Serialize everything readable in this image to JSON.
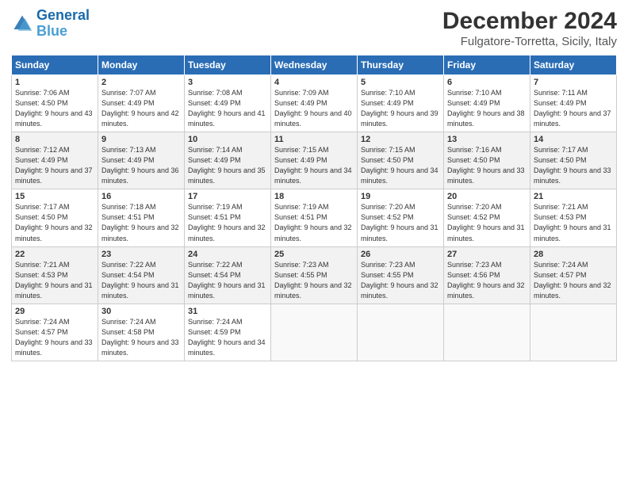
{
  "header": {
    "logo_line1": "General",
    "logo_line2": "Blue",
    "main_title": "December 2024",
    "subtitle": "Fulgatore-Torretta, Sicily, Italy"
  },
  "days_of_week": [
    "Sunday",
    "Monday",
    "Tuesday",
    "Wednesday",
    "Thursday",
    "Friday",
    "Saturday"
  ],
  "weeks": [
    [
      {
        "day": 1,
        "rise": "7:06 AM",
        "set": "4:50 PM",
        "daylight": "9 hours and 43 minutes."
      },
      {
        "day": 2,
        "rise": "7:07 AM",
        "set": "4:49 PM",
        "daylight": "9 hours and 42 minutes."
      },
      {
        "day": 3,
        "rise": "7:08 AM",
        "set": "4:49 PM",
        "daylight": "9 hours and 41 minutes."
      },
      {
        "day": 4,
        "rise": "7:09 AM",
        "set": "4:49 PM",
        "daylight": "9 hours and 40 minutes."
      },
      {
        "day": 5,
        "rise": "7:10 AM",
        "set": "4:49 PM",
        "daylight": "9 hours and 39 minutes."
      },
      {
        "day": 6,
        "rise": "7:10 AM",
        "set": "4:49 PM",
        "daylight": "9 hours and 38 minutes."
      },
      {
        "day": 7,
        "rise": "7:11 AM",
        "set": "4:49 PM",
        "daylight": "9 hours and 37 minutes."
      }
    ],
    [
      {
        "day": 8,
        "rise": "7:12 AM",
        "set": "4:49 PM",
        "daylight": "9 hours and 37 minutes."
      },
      {
        "day": 9,
        "rise": "7:13 AM",
        "set": "4:49 PM",
        "daylight": "9 hours and 36 minutes."
      },
      {
        "day": 10,
        "rise": "7:14 AM",
        "set": "4:49 PM",
        "daylight": "9 hours and 35 minutes."
      },
      {
        "day": 11,
        "rise": "7:15 AM",
        "set": "4:49 PM",
        "daylight": "9 hours and 34 minutes."
      },
      {
        "day": 12,
        "rise": "7:15 AM",
        "set": "4:50 PM",
        "daylight": "9 hours and 34 minutes."
      },
      {
        "day": 13,
        "rise": "7:16 AM",
        "set": "4:50 PM",
        "daylight": "9 hours and 33 minutes."
      },
      {
        "day": 14,
        "rise": "7:17 AM",
        "set": "4:50 PM",
        "daylight": "9 hours and 33 minutes."
      }
    ],
    [
      {
        "day": 15,
        "rise": "7:17 AM",
        "set": "4:50 PM",
        "daylight": "9 hours and 32 minutes."
      },
      {
        "day": 16,
        "rise": "7:18 AM",
        "set": "4:51 PM",
        "daylight": "9 hours and 32 minutes."
      },
      {
        "day": 17,
        "rise": "7:19 AM",
        "set": "4:51 PM",
        "daylight": "9 hours and 32 minutes."
      },
      {
        "day": 18,
        "rise": "7:19 AM",
        "set": "4:51 PM",
        "daylight": "9 hours and 32 minutes."
      },
      {
        "day": 19,
        "rise": "7:20 AM",
        "set": "4:52 PM",
        "daylight": "9 hours and 31 minutes."
      },
      {
        "day": 20,
        "rise": "7:20 AM",
        "set": "4:52 PM",
        "daylight": "9 hours and 31 minutes."
      },
      {
        "day": 21,
        "rise": "7:21 AM",
        "set": "4:53 PM",
        "daylight": "9 hours and 31 minutes."
      }
    ],
    [
      {
        "day": 22,
        "rise": "7:21 AM",
        "set": "4:53 PM",
        "daylight": "9 hours and 31 minutes."
      },
      {
        "day": 23,
        "rise": "7:22 AM",
        "set": "4:54 PM",
        "daylight": "9 hours and 31 minutes."
      },
      {
        "day": 24,
        "rise": "7:22 AM",
        "set": "4:54 PM",
        "daylight": "9 hours and 31 minutes."
      },
      {
        "day": 25,
        "rise": "7:23 AM",
        "set": "4:55 PM",
        "daylight": "9 hours and 32 minutes."
      },
      {
        "day": 26,
        "rise": "7:23 AM",
        "set": "4:55 PM",
        "daylight": "9 hours and 32 minutes."
      },
      {
        "day": 27,
        "rise": "7:23 AM",
        "set": "4:56 PM",
        "daylight": "9 hours and 32 minutes."
      },
      {
        "day": 28,
        "rise": "7:24 AM",
        "set": "4:57 PM",
        "daylight": "9 hours and 32 minutes."
      }
    ],
    [
      {
        "day": 29,
        "rise": "7:24 AM",
        "set": "4:57 PM",
        "daylight": "9 hours and 33 minutes."
      },
      {
        "day": 30,
        "rise": "7:24 AM",
        "set": "4:58 PM",
        "daylight": "9 hours and 33 minutes."
      },
      {
        "day": 31,
        "rise": "7:24 AM",
        "set": "4:59 PM",
        "daylight": "9 hours and 34 minutes."
      },
      null,
      null,
      null,
      null
    ]
  ]
}
